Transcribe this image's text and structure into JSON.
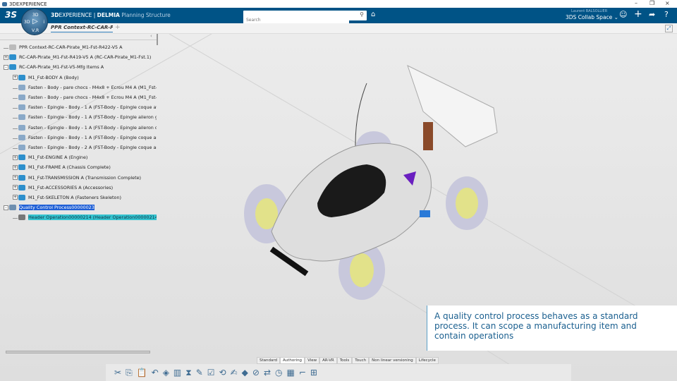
{
  "window": {
    "title": "3DEXPERIENCE",
    "minimize": "–",
    "restore": "❐",
    "close": "×"
  },
  "topbar": {
    "brand_bold": "3D",
    "brand_rest": "EXPERIENCE | ",
    "brand_app": "DELMIA",
    "app_name": "Planning Structure",
    "search_placeholder": "Search",
    "user": "Laurent BALSOLLIER",
    "collab_space": "3DS Collab Space",
    "compass": {
      "top": "3D",
      "left": "3D",
      "right": "i",
      "bottom": "V,R"
    }
  },
  "tabs": [
    {
      "label": "PPR Context-RC-CAR-Pira",
      "active": true
    }
  ],
  "tree": {
    "items": [
      {
        "label": "PPR Context-RC-CAR-Pirate_M1-Fst-R422-V5 A",
        "level": 0,
        "expander": "",
        "type": "ppr"
      },
      {
        "label": "RC-CAR-Pirate_M1-Fst-R419-V5 A (RC-CAR-Pirate_M1-Fst.1)",
        "level": 0,
        "expander": "+",
        "type": "product"
      },
      {
        "label": "RC-CAR-Pirate_M1-Fst-V5-Mfg Items A",
        "level": 0,
        "expander": "-",
        "type": "mfg"
      },
      {
        "label": "M1_Fst-BODY A (Body)",
        "level": 1,
        "expander": "+",
        "type": "product"
      },
      {
        "label": "Fasten - Body - pare chocs - M4x8 + Ecrou M4 A (M1_Fst-",
        "level": 1,
        "expander": "",
        "type": "fasten"
      },
      {
        "label": "Fasten - Body - pare chocs - M4x8 + Ecrou M4 A (M1_Fst-",
        "level": 1,
        "expander": "",
        "type": "fasten"
      },
      {
        "label": "Fasten - Epingle - Body - 1 A (FST-Body - Epingle coque av",
        "level": 1,
        "expander": "",
        "type": "fasten"
      },
      {
        "label": "Fasten - Epingle - Body - 1 A (FST-Body - Epingle aileron g",
        "level": 1,
        "expander": "",
        "type": "fasten"
      },
      {
        "label": "Fasten - Epingle - Body - 1 A (FST-Body - Epingle aileron d",
        "level": 1,
        "expander": "",
        "type": "fasten"
      },
      {
        "label": "Fasten - Epingle - Body - 1 A (FST-Body - Epingle coque an",
        "level": 1,
        "expander": "",
        "type": "fasten"
      },
      {
        "label": "Fasten - Epingle - Body - 2 A (FST-Body - Epingle coque an",
        "level": 1,
        "expander": "",
        "type": "fasten"
      },
      {
        "label": "M1_Fst-ENGINE A (Engine)",
        "level": 1,
        "expander": "+",
        "type": "product"
      },
      {
        "label": "M1_Fst-FRAME A (Chassis Complete)",
        "level": 1,
        "expander": "+",
        "type": "product"
      },
      {
        "label": "M1_Fst-TRANSMISSION A (Transmission Complete)",
        "level": 1,
        "expander": "+",
        "type": "product"
      },
      {
        "label": "M1_Fst-ACCESSORIES A (Accessories)",
        "level": 1,
        "expander": "+",
        "type": "product"
      },
      {
        "label": "M1_Fst-SKELETON A (Fasteners Skeleton)",
        "level": 1,
        "expander": "+",
        "type": "product"
      },
      {
        "label": "Quality Control Process00000023",
        "level": 0,
        "expander": "-",
        "type": "process",
        "selected": "blue"
      },
      {
        "label": "Header Operation00000214 (Header Operation00000214.",
        "level": 1,
        "expander": "",
        "type": "operation",
        "selected": "cyan"
      }
    ]
  },
  "caption": "A quality control process behaves as a standard process. It can scope a manufacturing item and contain operations",
  "toolbar": {
    "tabs": [
      "Standard",
      "Authoring",
      "View",
      "AR-VR",
      "Tools",
      "Touch",
      "Non linear versioning",
      "Lifecycle"
    ],
    "active_tab": "Authoring",
    "icons": [
      "cut-icon",
      "copy-icon",
      "paste-icon",
      "undo-icon",
      "product-icon",
      "mfg-item-icon",
      "assign-icon",
      "fasten-icon",
      "check-icon",
      "link-icon",
      "edit-icon",
      "diamond-icon",
      "scope-icon",
      "swap-icon",
      "timer-icon",
      "table-icon",
      "gantt-icon",
      "tree-icon"
    ]
  },
  "colors": {
    "topbar": "#005386",
    "selection_blue": "#1f5fd6",
    "selection_cyan": "#35c4d0",
    "caption_text": "#1a5f8f"
  }
}
